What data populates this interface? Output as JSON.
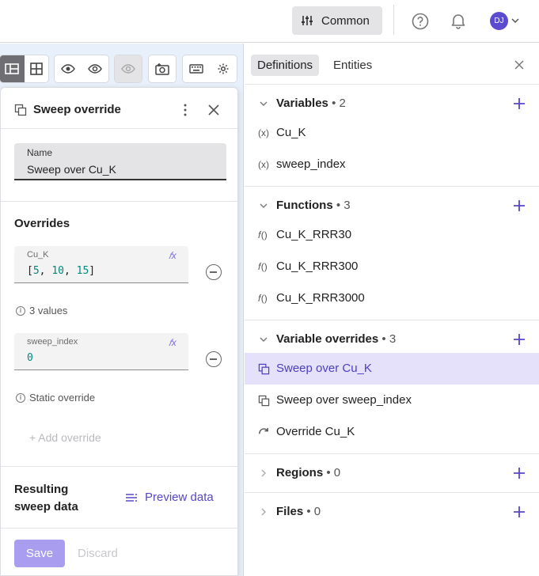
{
  "topbar": {
    "workspace_label": "Common",
    "avatar_initials": "DJ"
  },
  "card": {
    "title": "Sweep override",
    "name_label": "Name",
    "name_value": "Sweep over Cu_K",
    "overrides_title": "Overrides",
    "overrides": [
      {
        "variable": "Cu_K",
        "fx": "𝑓x",
        "value_open": "[",
        "values": [
          "5",
          "10",
          "15"
        ],
        "value_close": "]",
        "hint": "3 values"
      },
      {
        "variable": "sweep_index",
        "fx": "𝑓x",
        "value": "0",
        "hint": "Static override"
      }
    ],
    "add_override_label": "+ Add override",
    "resulting_label": "Resulting sweep data",
    "preview_label": "Preview data",
    "save_label": "Save",
    "discard_label": "Discard"
  },
  "panel": {
    "tabs": [
      {
        "label": "Definitions",
        "active": true
      },
      {
        "label": "Entities",
        "active": false
      }
    ],
    "sections": [
      {
        "title": "Variables",
        "count": "• 2",
        "expanded": true,
        "items": [
          {
            "label": "Cu_K",
            "icon": "variable-icon"
          },
          {
            "label": "sweep_index",
            "icon": "variable-icon"
          }
        ]
      },
      {
        "title": "Functions",
        "count": "• 3",
        "expanded": true,
        "items": [
          {
            "label": "Cu_K_RRR30",
            "icon": "function-icon"
          },
          {
            "label": "Cu_K_RRR300",
            "icon": "function-icon"
          },
          {
            "label": "Cu_K_RRR3000",
            "icon": "function-icon"
          }
        ]
      },
      {
        "title": "Variable overrides",
        "count": "• 3",
        "expanded": true,
        "items": [
          {
            "label": "Sweep over Cu_K",
            "icon": "sweep-icon",
            "selected": true
          },
          {
            "label": "Sweep over sweep_index",
            "icon": "sweep-icon"
          },
          {
            "label": "Override Cu_K",
            "icon": "override-icon"
          }
        ]
      },
      {
        "title": "Regions",
        "count": "• 0",
        "expanded": false,
        "items": []
      },
      {
        "title": "Files",
        "count": "• 0",
        "expanded": false,
        "items": []
      }
    ]
  },
  "colors": {
    "accent": "#5548c8",
    "selected_bg": "#e5e1fb",
    "save_disabled": "#a99df0",
    "viewport_bg": "#e8f1fb"
  }
}
